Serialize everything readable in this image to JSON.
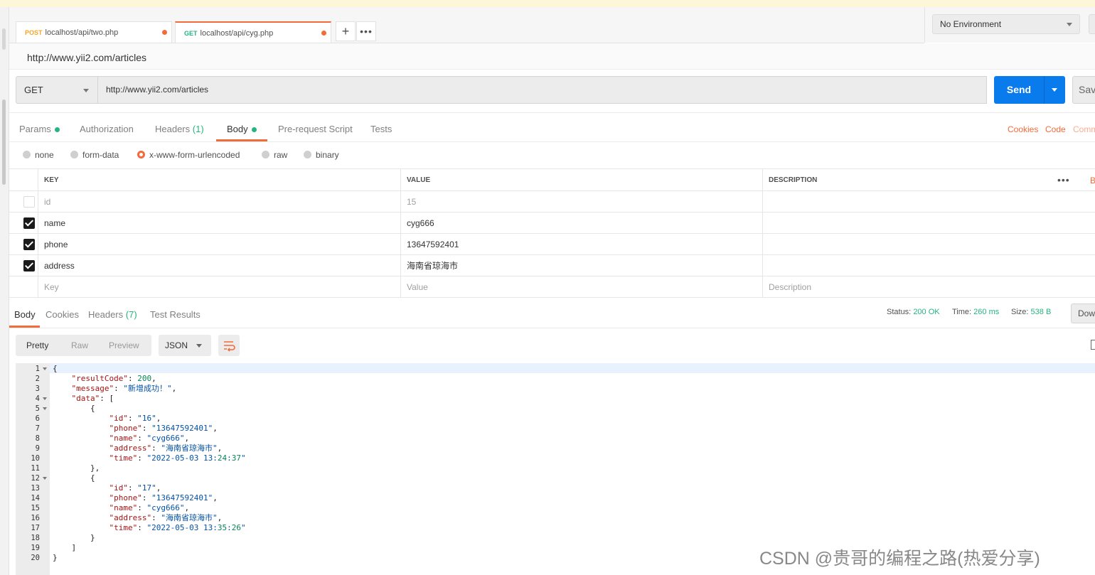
{
  "tabs": [
    {
      "method": "POST",
      "url": "localhost/api/two.php",
      "method_color": "#f5a623"
    },
    {
      "method": "GET",
      "url": "localhost/api/cyg.php",
      "method_color": "#26b47f"
    }
  ],
  "environment": {
    "label": "No Environment"
  },
  "request": {
    "name": "http://www.yii2.com/articles",
    "method": "GET",
    "url": "http://www.yii2.com/articles",
    "send_label": "Send",
    "save_label": "Sav"
  },
  "request_tabs": {
    "params": "Params",
    "authorization": "Authorization",
    "headers": "Headers",
    "headers_count": "(1)",
    "body": "Body",
    "prerequest": "Pre-request Script",
    "tests": "Tests",
    "cookies": "Cookies",
    "code": "Code",
    "comments": "Comm"
  },
  "body_types": [
    "none",
    "form-data",
    "x-www-form-urlencoded",
    "raw",
    "binary"
  ],
  "body_type_selected": "x-www-form-urlencoded",
  "kv_table": {
    "headers": {
      "key": "KEY",
      "value": "VALUE",
      "description": "DESCRIPTION"
    },
    "bulk": "B",
    "rows": [
      {
        "key": "id",
        "value": "15",
        "description": "",
        "checked": false
      },
      {
        "key": "name",
        "value": "cyg666",
        "description": "",
        "checked": true
      },
      {
        "key": "phone",
        "value": "13647592401",
        "description": "",
        "checked": true
      },
      {
        "key": "address",
        "value": "海南省琼海市",
        "description": "",
        "checked": true
      }
    ],
    "placeholders": {
      "key": "Key",
      "value": "Value",
      "description": "Description"
    }
  },
  "response": {
    "tabs": {
      "body": "Body",
      "cookies": "Cookies",
      "headers": "Headers",
      "headers_count": "(7)",
      "test_results": "Test Results"
    },
    "status_label": "Status:",
    "status": "200 OK",
    "time_label": "Time:",
    "time": "260 ms",
    "size_label": "Size:",
    "size": "538 B",
    "download": "Dow",
    "views": {
      "pretty": "Pretty",
      "raw": "Raw",
      "preview": "Preview"
    },
    "format": "JSON"
  },
  "code_lines": [
    "{",
    "    \"resultCode\": 200,",
    "    \"message\": \"新增成功！\",",
    "    \"data\": [",
    "        {",
    "            \"id\": \"16\",",
    "            \"phone\": \"13647592401\",",
    "            \"name\": \"cyg666\",",
    "            \"address\": \"海南省琼海市\",",
    "            \"time\": \"2022-05-03 13:24:37\"",
    "        },",
    "        {",
    "            \"id\": \"17\",",
    "            \"phone\": \"13647592401\",",
    "            \"name\": \"cyg666\",",
    "            \"address\": \"海南省琼海市\",",
    "            \"time\": \"2022-05-03 13:35:26\"",
    "        }",
    "    ]",
    "}"
  ],
  "fold_lines": [
    1,
    4,
    5,
    12
  ],
  "watermark": "CSDN @贵哥的编程之路(热爱分享)",
  "colors": {
    "accent": "#f26b3a",
    "send": "#097bed",
    "success": "#26b47f"
  }
}
